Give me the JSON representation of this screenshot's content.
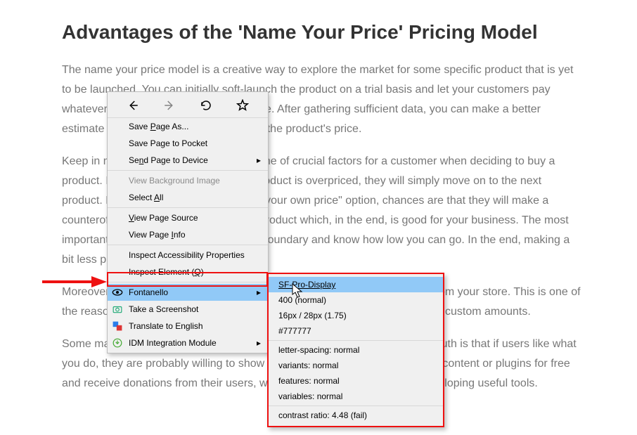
{
  "article": {
    "title": "Advantages of the 'Name Your Price' Pricing Model",
    "p1": "The name your price model is a creative way to explore the market for some specific product that is yet to be launched. You can initially soft-launch the product on a trial basis and let your customers pay whatever they see as an appropriate price. After gathering sufficient data, you can make a better estimate and decide on a fair number for the product's price.",
    "p2": "Keep in mind that affordable prices are one of crucial factors for a customer when deciding to buy a product. If users find out that a certain product is overpriced, they will simply move on to the next product. However, by offering the \"name your own price\" option, chances are that they will make a counteroffer, and you might still sell the product which, in the end, is good for your business. The most important thing is that you have to set a boundary and know how low you can go. In the end, making a bit less profit is better than none.",
    "p3": "Moreover, you can use NYP to collect charity donations or run fundraisers from your store. This is one of the reasons why many websites have a \"Donation\" button where users enter custom amounts.",
    "p4": "Some may think \"Why would someone pay more than necessary?\" but the truth is that if users like what you do, they are probably willing to show their appreciation. Many sites offer content or plugins for free and receive donations from their users, which motivates them and keep developing useful tools."
  },
  "contextmenu": {
    "save_as": "Save Page As...",
    "save_pocket": "Save Page to Pocket",
    "send_device": "Send Page to Device",
    "view_bg": "View Background Image",
    "select_all": "Select All",
    "view_source": "View Page Source",
    "view_info": "View Page Info",
    "inspect_a11y": "Inspect Accessibility Properties",
    "inspect_el_pre": "Inspect Element (",
    "inspect_el_key": "Q",
    "inspect_el_post": ")",
    "fontanello": "Fontanello",
    "screenshot": "Take a Screenshot",
    "translate": "Translate to English",
    "idm": "IDM Integration Module"
  },
  "submenu": {
    "font": "SF-Pro-Display",
    "weight": "400 (normal)",
    "size": "16px / 28px (1.75)",
    "color": "#777777",
    "ls": "letter-spacing: normal",
    "variants": "variants: normal",
    "features": "features: normal",
    "variables": "variables: normal",
    "contrast": "contrast ratio: 4.48 (fail)"
  }
}
